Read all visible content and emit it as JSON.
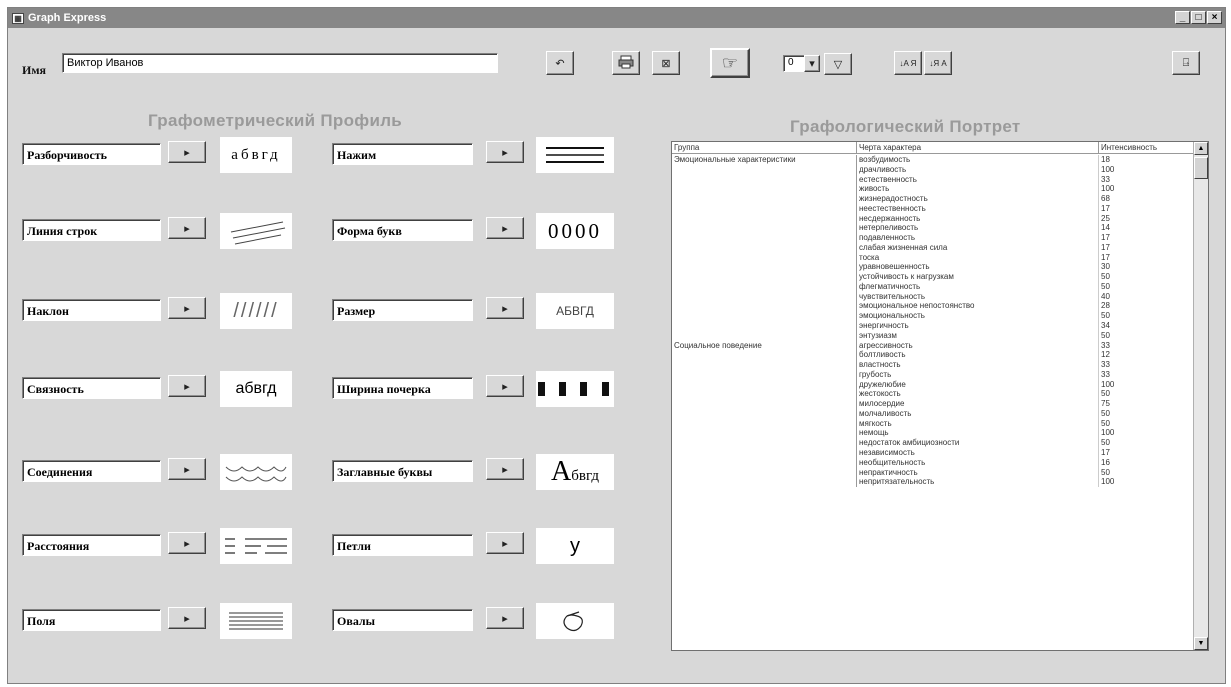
{
  "window": {
    "title": "Graph Express",
    "controls": [
      "_",
      "□",
      "×"
    ]
  },
  "name_field": {
    "label": "Имя",
    "value": "Виктор Иванов"
  },
  "toolbar": {
    "undo": "↶",
    "print": "🖶",
    "clear": "⊠",
    "hand": "☞",
    "counter_value": "0",
    "dropdown": "▾",
    "filter": "▽",
    "sort_asc": "↓A Я",
    "sort_desc": "↓Я A",
    "exit": "⍈"
  },
  "profile": {
    "heading": "Графометрический Профиль",
    "left": [
      {
        "label": "Разборчивость",
        "sample": "абвгд",
        "sample_kind": "text-serif"
      },
      {
        "label": "Линия строк",
        "sample": "",
        "sample_kind": "lines-slanted"
      },
      {
        "label": "Наклон",
        "sample": "//////",
        "sample_kind": "text-italic"
      },
      {
        "label": "Связность",
        "sample": "абвгд",
        "sample_kind": "text-sans"
      },
      {
        "label": "Соединения",
        "sample": "",
        "sample_kind": "waves"
      },
      {
        "label": "Расстояния",
        "sample": "",
        "sample_kind": "dashes"
      },
      {
        "label": "Поля",
        "sample": "",
        "sample_kind": "hlines"
      }
    ],
    "right": [
      {
        "label": "Нажим",
        "sample": "",
        "sample_kind": "thick-lines"
      },
      {
        "label": "Форма букв",
        "sample": "0000",
        "sample_kind": "text-serif-lg"
      },
      {
        "label": "Размер",
        "sample": "АБВГД",
        "sample_kind": "text-small"
      },
      {
        "label": "Ширина почерка",
        "sample": "",
        "sample_kind": "blocks"
      },
      {
        "label": "Заглавные буквы",
        "sample": "Абвгд",
        "sample_kind": "capital"
      },
      {
        "label": "Петли",
        "sample": "у",
        "sample_kind": "text-sans-lg"
      },
      {
        "label": "Овалы",
        "sample": "",
        "sample_kind": "oval"
      }
    ],
    "button_glyph": "▸"
  },
  "portrait": {
    "heading": "Графологический Портрет",
    "columns": [
      "Группа",
      "Черта характера",
      "Интенсивность"
    ],
    "rows": [
      [
        "Эмоциональные характеристики",
        "возбудимость",
        "18"
      ],
      [
        "",
        "драчливость",
        "100"
      ],
      [
        "",
        "естественность",
        "33"
      ],
      [
        "",
        "живость",
        "100"
      ],
      [
        "",
        "жизнерадостность",
        "68"
      ],
      [
        "",
        "неестественность",
        "17"
      ],
      [
        "",
        "несдержанность",
        "25"
      ],
      [
        "",
        "нетерпеливость",
        "14"
      ],
      [
        "",
        "подавленность",
        "17"
      ],
      [
        "",
        "слабая жизненная сила",
        "17"
      ],
      [
        "",
        "тоска",
        "17"
      ],
      [
        "",
        "уравновешенность",
        "30"
      ],
      [
        "",
        "устойчивость к нагрузкам",
        "50"
      ],
      [
        "",
        "флегматичность",
        "50"
      ],
      [
        "",
        "чувствительность",
        "40"
      ],
      [
        "",
        "эмоциональное непостоянство",
        "28"
      ],
      [
        "",
        "эмоциональность",
        "50"
      ],
      [
        "",
        "энергичность",
        "34"
      ],
      [
        "",
        "энтузиазм",
        "50"
      ],
      [
        "Социальное поведение",
        "агрессивность",
        "33"
      ],
      [
        "",
        "болтливость",
        "12"
      ],
      [
        "",
        "властность",
        "33"
      ],
      [
        "",
        "грубость",
        "33"
      ],
      [
        "",
        "дружелюбие",
        "100"
      ],
      [
        "",
        "жестокость",
        "50"
      ],
      [
        "",
        "милосердие",
        "75"
      ],
      [
        "",
        "молчаливость",
        "50"
      ],
      [
        "",
        "мягкость",
        "50"
      ],
      [
        "",
        "немощь",
        "100"
      ],
      [
        "",
        "недостаток амбициозности",
        "50"
      ],
      [
        "",
        "независимость",
        "17"
      ],
      [
        "",
        "необщительность",
        "16"
      ],
      [
        "",
        "непрактичность",
        "50"
      ],
      [
        "",
        "непритязательность",
        "100"
      ]
    ]
  }
}
